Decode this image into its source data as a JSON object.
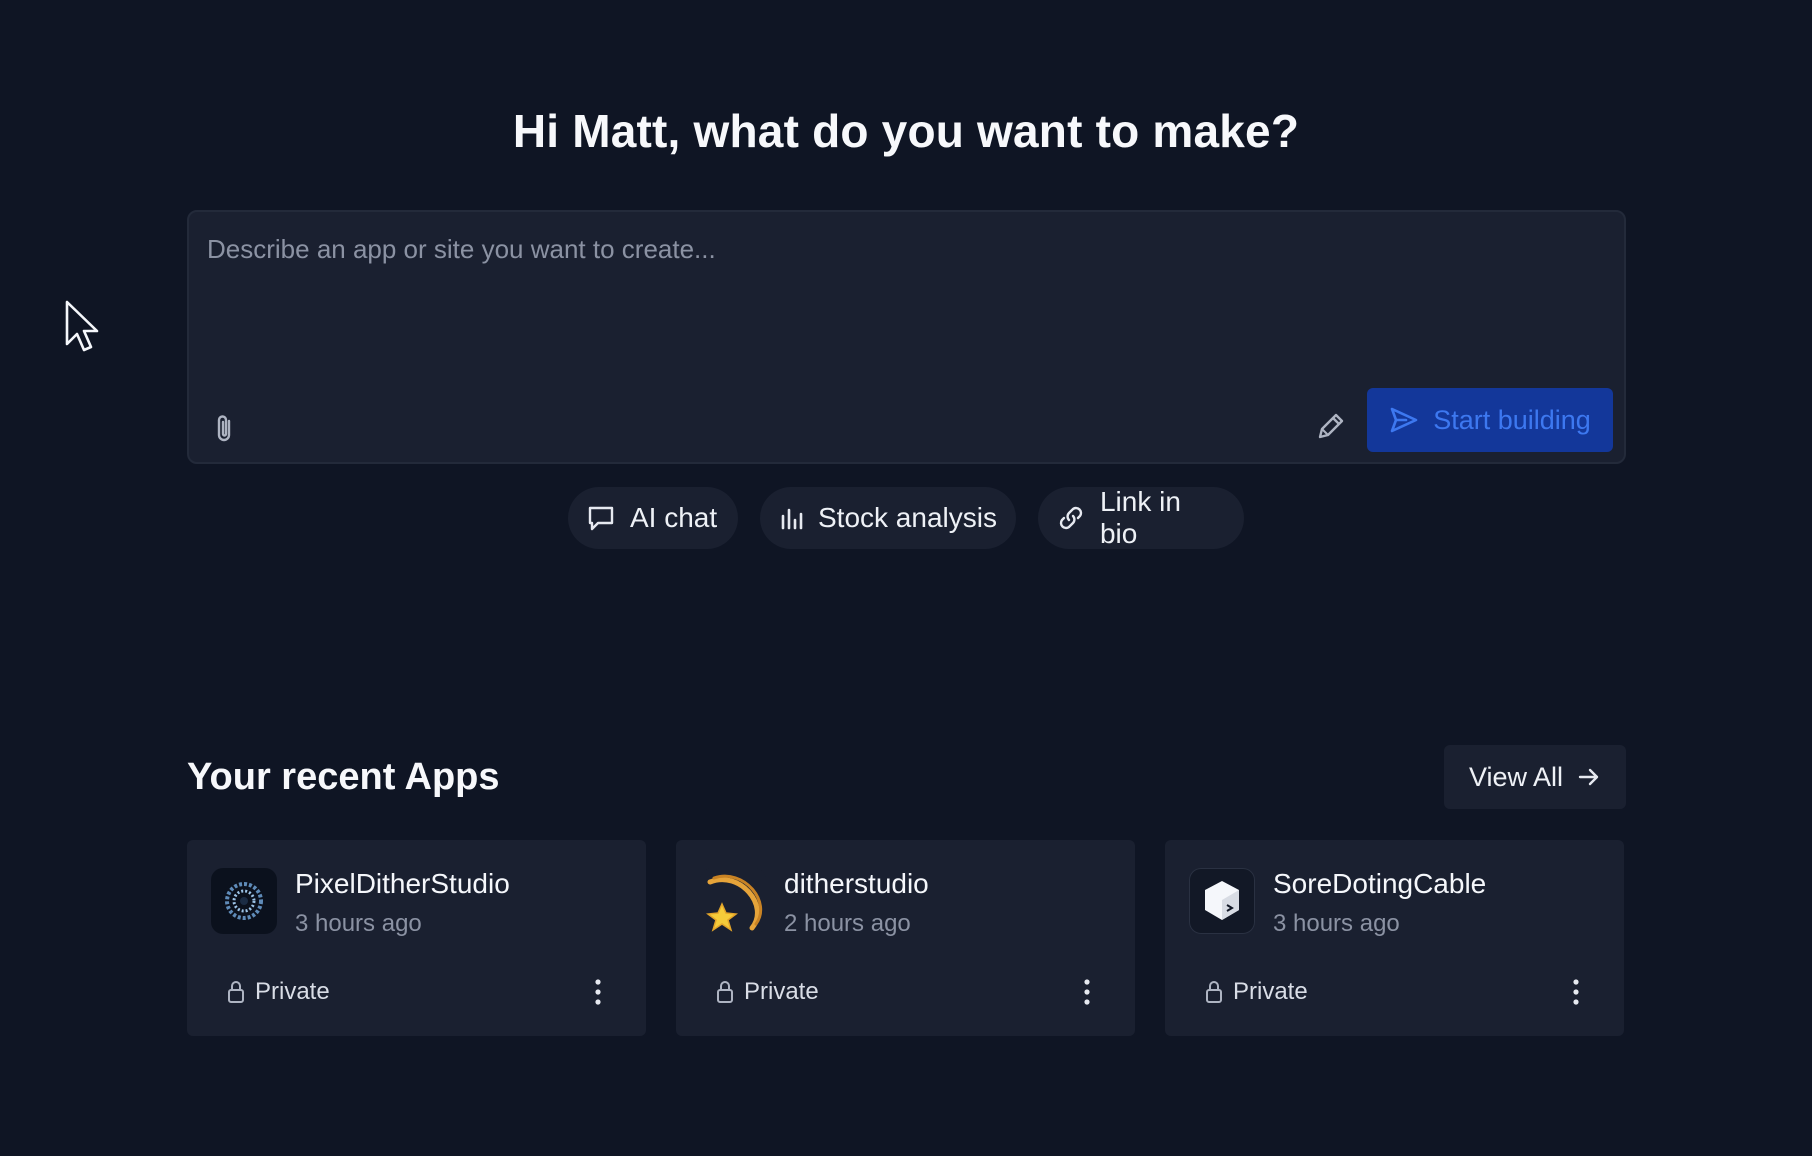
{
  "greeting": "Hi Matt, what do you want to make?",
  "composer": {
    "placeholder": "Describe an app or site you want to create...",
    "value": "",
    "submit_label": "Start building"
  },
  "suggestions": [
    {
      "label": "AI chat",
      "icon": "chat-bubble-icon"
    },
    {
      "label": "Stock analysis",
      "icon": "bar-chart-icon"
    },
    {
      "label": "Link in bio",
      "icon": "link-icon"
    }
  ],
  "recent": {
    "title": "Your recent Apps",
    "view_all_label": "View All",
    "apps": [
      {
        "name": "PixelDitherStudio",
        "updated": "3 hours ago",
        "visibility": "Private",
        "icon": "pixel-dither-logo"
      },
      {
        "name": "ditherstudio",
        "updated": "2 hours ago",
        "visibility": "Private",
        "icon": "shooting-star-emoji"
      },
      {
        "name": "SoreDotingCable",
        "updated": "3 hours ago",
        "visibility": "Private",
        "icon": "terminal-cube-logo"
      }
    ]
  },
  "colors": {
    "background": "#0f1524",
    "surface": "#1a2030",
    "accent_button_bg": "#13379a",
    "accent_text": "#3d78f0",
    "muted_text": "#8b92a3"
  }
}
